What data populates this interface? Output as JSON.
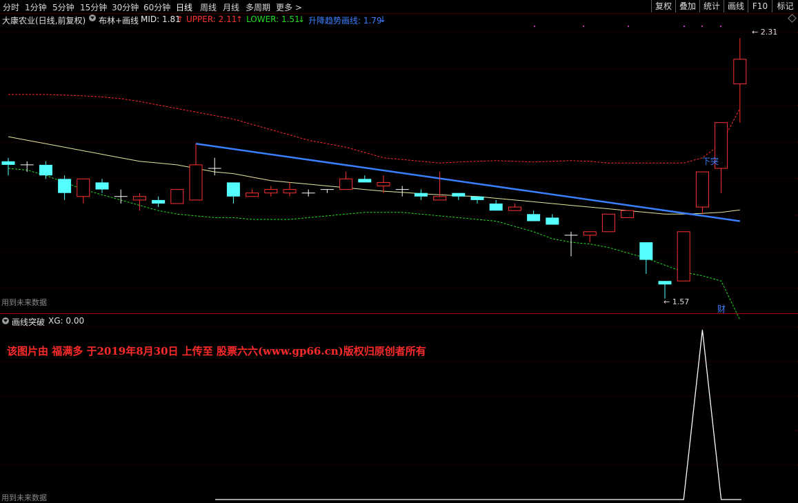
{
  "toolbar": {
    "periods": [
      "分时",
      "1分钟",
      "5分钟",
      "15分钟",
      "30分钟",
      "60分钟",
      "日线",
      "周线",
      "月线",
      "多周期",
      "更多 >"
    ],
    "active_period": "日线",
    "right_buttons": [
      "复权",
      "叠加",
      "统计",
      "画线",
      "F10",
      "标记"
    ]
  },
  "legend": {
    "stock": "大康农业(日线,前复权)",
    "indicator": "布林+画线",
    "mid_label": "MID: 1.81",
    "mid_arrow": "↑",
    "upper_label": "UPPER: 2.11",
    "upper_arrow": "↑",
    "lower_label": "LOWER: 1.51",
    "lower_arrow": "↓",
    "trend_label": "升降趋势画线: 1.79",
    "trend_arrow": "↓"
  },
  "annotations": {
    "high_price": "2.31",
    "low_price": "1.57",
    "breakthrough": "下突",
    "cai": "财",
    "future_data_top": "用到未来数据",
    "future_data_bottom": "用到未来数据"
  },
  "sub_legend": {
    "name": "画线突破",
    "value": "XG: 0.00"
  },
  "watermark": "该图片由 福满多 于2019年8月30日 上传至 股票六六(www.gp66.cn)版权归原创者所有",
  "colors": {
    "up": "#ff3232",
    "down": "#54ffff",
    "mid": "#e8e8a0",
    "upper": "#ff2a2a",
    "lower": "#22dd22",
    "trend": "#3a7fff",
    "background": "#000000"
  },
  "chart_data": {
    "type": "candlestick",
    "price_range": [
      1.54,
      2.34
    ],
    "candles": [
      {
        "o": 1.96,
        "h": 1.97,
        "l": 1.92,
        "c": 1.95
      },
      {
        "o": 1.95,
        "h": 1.96,
        "l": 1.93,
        "c": 1.95
      },
      {
        "o": 1.95,
        "h": 1.96,
        "l": 1.91,
        "c": 1.92
      },
      {
        "o": 1.91,
        "h": 1.92,
        "l": 1.85,
        "c": 1.87
      },
      {
        "o": 1.86,
        "h": 1.91,
        "l": 1.84,
        "c": 1.91
      },
      {
        "o": 1.9,
        "h": 1.91,
        "l": 1.87,
        "c": 1.88
      },
      {
        "o": 1.86,
        "h": 1.88,
        "l": 1.84,
        "c": 1.86
      },
      {
        "o": 1.85,
        "h": 1.87,
        "l": 1.82,
        "c": 1.86
      },
      {
        "o": 1.85,
        "h": 1.86,
        "l": 1.83,
        "c": 1.84
      },
      {
        "o": 1.84,
        "h": 1.88,
        "l": 1.84,
        "c": 1.88
      },
      {
        "o": 1.85,
        "h": 1.95,
        "l": 1.85,
        "c": 1.95
      },
      {
        "o": 1.94,
        "h": 1.97,
        "l": 1.92,
        "c": 1.94
      },
      {
        "o": 1.9,
        "h": 1.9,
        "l": 1.84,
        "c": 1.86
      },
      {
        "o": 1.86,
        "h": 1.88,
        "l": 1.86,
        "c": 1.87
      },
      {
        "o": 1.87,
        "h": 1.89,
        "l": 1.86,
        "c": 1.88
      },
      {
        "o": 1.87,
        "h": 1.9,
        "l": 1.86,
        "c": 1.88
      },
      {
        "o": 1.87,
        "h": 1.88,
        "l": 1.86,
        "c": 1.87
      },
      {
        "o": 1.88,
        "h": 1.88,
        "l": 1.87,
        "c": 1.88
      },
      {
        "o": 1.88,
        "h": 1.93,
        "l": 1.88,
        "c": 1.91
      },
      {
        "o": 1.91,
        "h": 1.92,
        "l": 1.9,
        "c": 1.9
      },
      {
        "o": 1.89,
        "h": 1.92,
        "l": 1.87,
        "c": 1.9
      },
      {
        "o": 1.88,
        "h": 1.89,
        "l": 1.86,
        "c": 1.88
      },
      {
        "o": 1.87,
        "h": 1.88,
        "l": 1.85,
        "c": 1.86
      },
      {
        "o": 1.85,
        "h": 1.93,
        "l": 1.85,
        "c": 1.86
      },
      {
        "o": 1.87,
        "h": 1.87,
        "l": 1.85,
        "c": 1.86
      },
      {
        "o": 1.86,
        "h": 1.86,
        "l": 1.84,
        "c": 1.85
      },
      {
        "o": 1.84,
        "h": 1.85,
        "l": 1.82,
        "c": 1.82
      },
      {
        "o": 1.82,
        "h": 1.84,
        "l": 1.82,
        "c": 1.83
      },
      {
        "o": 1.81,
        "h": 1.82,
        "l": 1.79,
        "c": 1.79
      },
      {
        "o": 1.8,
        "h": 1.81,
        "l": 1.78,
        "c": 1.78
      },
      {
        "o": 1.75,
        "h": 1.76,
        "l": 1.69,
        "c": 1.75
      },
      {
        "o": 1.75,
        "h": 1.76,
        "l": 1.73,
        "c": 1.76
      },
      {
        "o": 1.76,
        "h": 1.81,
        "l": 1.76,
        "c": 1.81
      },
      {
        "o": 1.8,
        "h": 1.82,
        "l": 1.8,
        "c": 1.82
      },
      {
        "o": 1.73,
        "h": 1.73,
        "l": 1.64,
        "c": 1.68
      },
      {
        "o": 1.62,
        "h": 1.62,
        "l": 1.57,
        "c": 1.61
      },
      {
        "o": 1.62,
        "h": 1.76,
        "l": 1.62,
        "c": 1.76
      },
      {
        "o": 1.83,
        "h": 1.93,
        "l": 1.81,
        "c": 1.93
      },
      {
        "o": 1.94,
        "h": 2.07,
        "l": 1.87,
        "c": 2.07
      },
      {
        "o": 2.18,
        "h": 2.31,
        "l": 2.07,
        "c": 2.25
      }
    ],
    "mid": [
      2.03,
      2.02,
      2.01,
      2.0,
      1.99,
      1.98,
      1.97,
      1.96,
      1.955,
      1.95,
      1.94,
      1.93,
      1.925,
      1.915,
      1.905,
      1.9,
      1.895,
      1.89,
      1.885,
      1.88,
      1.875,
      1.872,
      1.868,
      1.865,
      1.862,
      1.86,
      1.855,
      1.85,
      1.845,
      1.84,
      1.835,
      1.83,
      1.825,
      1.82,
      1.815,
      1.81,
      1.81,
      1.812,
      1.815,
      1.822
    ],
    "upper": [
      2.15,
      2.15,
      2.15,
      2.148,
      2.146,
      2.143,
      2.138,
      2.13,
      2.12,
      2.11,
      2.1,
      2.09,
      2.08,
      2.065,
      2.05,
      2.035,
      2.02,
      2.01,
      2.0,
      1.985,
      1.97,
      1.965,
      1.96,
      1.955,
      1.958,
      1.96,
      1.962,
      1.96,
      1.958,
      1.96,
      1.962,
      1.96,
      1.955,
      1.955,
      1.955,
      1.955,
      1.955,
      1.97,
      2.01,
      2.11
    ],
    "lower": [
      1.94,
      1.935,
      1.92,
      1.9,
      1.88,
      1.865,
      1.85,
      1.835,
      1.82,
      1.81,
      1.805,
      1.8,
      1.8,
      1.795,
      1.795,
      1.795,
      1.8,
      1.805,
      1.81,
      1.815,
      1.815,
      1.815,
      1.81,
      1.805,
      1.8,
      1.795,
      1.79,
      1.775,
      1.76,
      1.74,
      1.73,
      1.725,
      1.715,
      1.7,
      1.685,
      1.665,
      1.645,
      1.635,
      1.62,
      1.51
    ],
    "trend_line": {
      "from_index": 10,
      "from_value": 2.01,
      "to_index": 39,
      "to_value": 1.79
    },
    "xg_signal": [
      0,
      0,
      0,
      0,
      0,
      0,
      0,
      0,
      0,
      0,
      0,
      0,
      0,
      0,
      0,
      0,
      0,
      0,
      0,
      0,
      0,
      0,
      0,
      0,
      0,
      0,
      0,
      0,
      0,
      0,
      0,
      0,
      0,
      0,
      0,
      0,
      0,
      1,
      0,
      0
    ],
    "gridlines": true
  }
}
